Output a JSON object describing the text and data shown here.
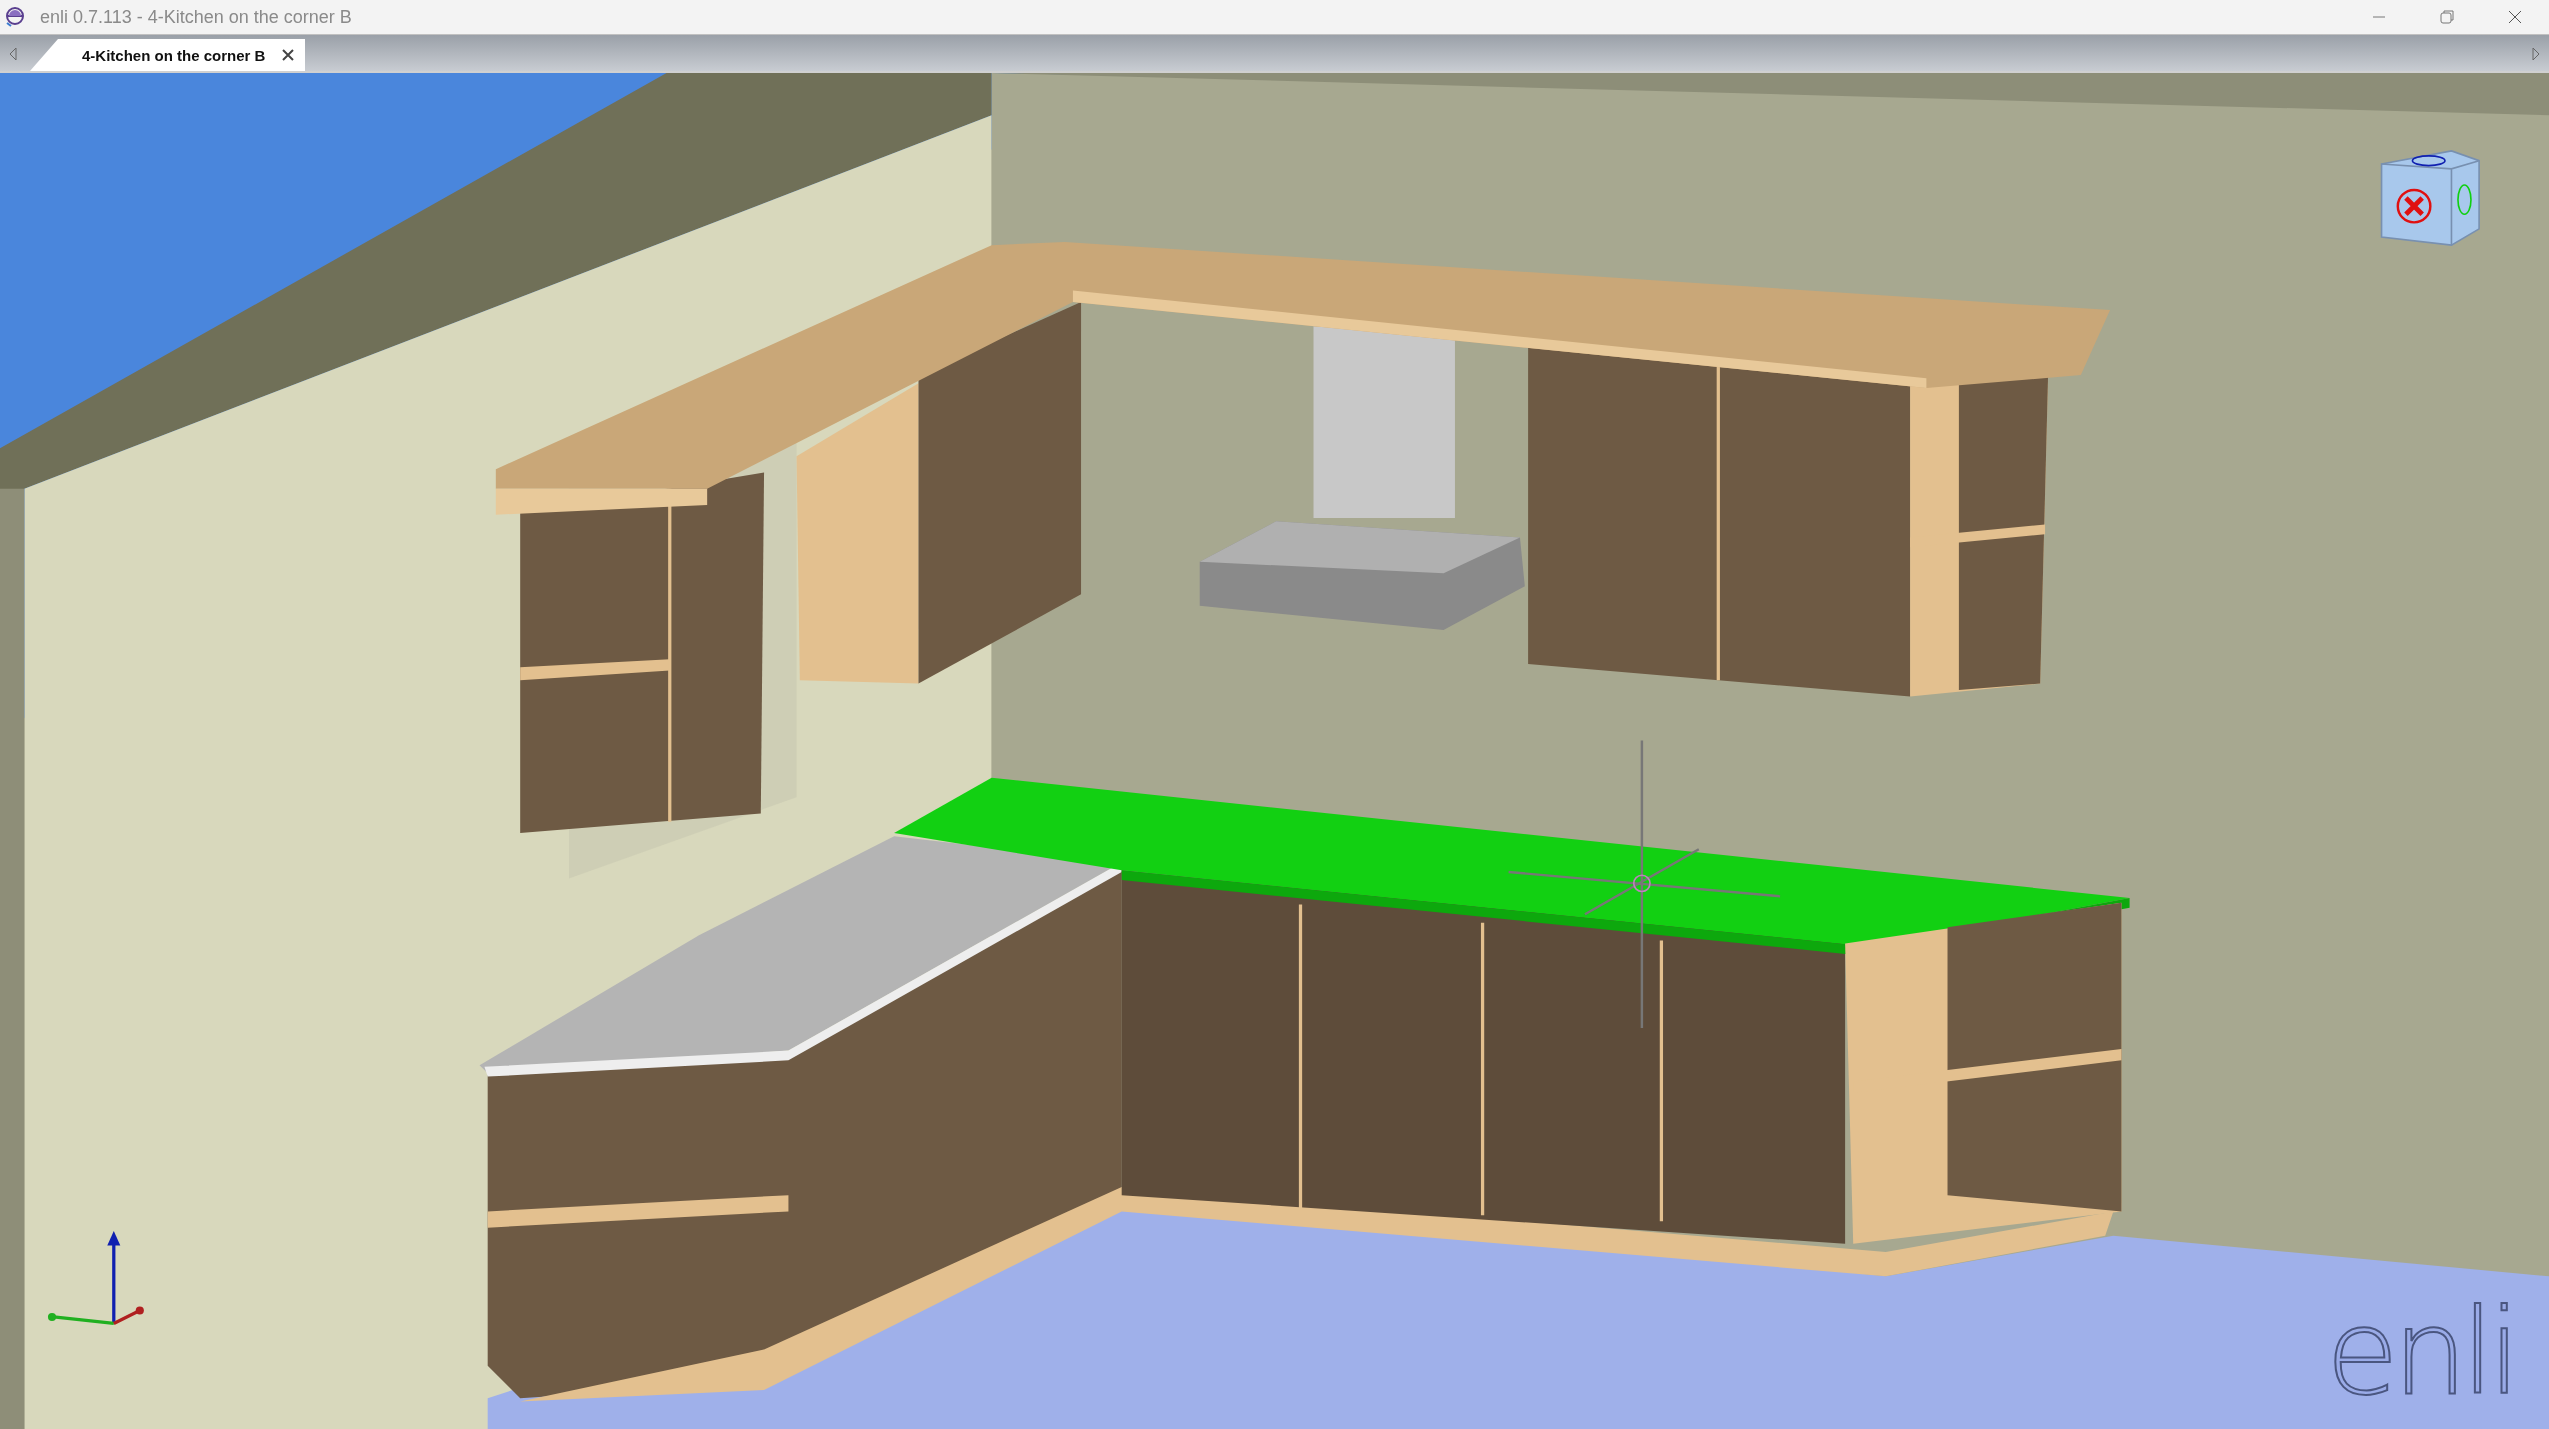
{
  "window": {
    "title": "enli 0.7.113 - 4-Kitchen on the corner B"
  },
  "tabs": [
    {
      "label": "4-Kitchen on the corner B",
      "selected": true
    }
  ],
  "viewport": {
    "logo": "enli"
  }
}
